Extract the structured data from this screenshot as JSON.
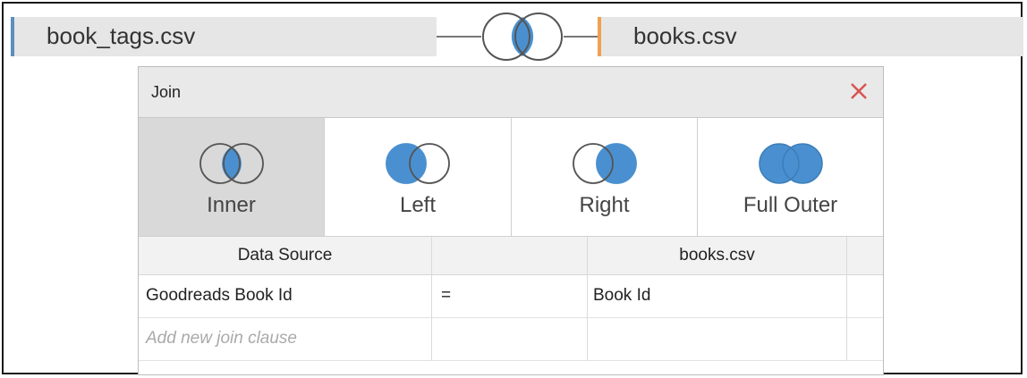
{
  "join_bar": {
    "left_table": "book_tags.csv",
    "right_table": "books.csv",
    "join_icon": "inner-join-icon"
  },
  "dialog": {
    "title": "Join",
    "close_icon": "close-icon",
    "join_types": [
      {
        "label": "Inner",
        "icon": "inner-join-icon",
        "selected": true
      },
      {
        "label": "Left",
        "icon": "left-join-icon",
        "selected": false
      },
      {
        "label": "Right",
        "icon": "right-join-icon",
        "selected": false
      },
      {
        "label": "Full Outer",
        "icon": "full-outer-join-icon",
        "selected": false
      }
    ],
    "clause_table": {
      "columns": [
        "Data Source",
        "",
        "books.csv"
      ],
      "rows": [
        {
          "left": "Goodreads Book Id",
          "operator": "=",
          "right": "Book Id"
        }
      ],
      "add_placeholder": "Add new join clause"
    }
  },
  "colors": {
    "venn_fill": "#4a90d0",
    "left_accent": "#5b8fbf",
    "right_accent": "#f0a050",
    "close_red": "#d9534f",
    "selected_bg": "#d9d9d9"
  }
}
